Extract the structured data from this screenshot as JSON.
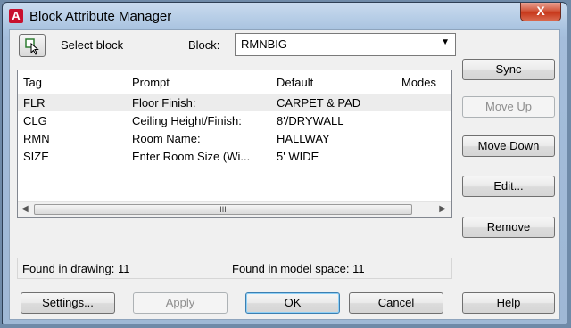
{
  "window": {
    "title": "Block Attribute Manager",
    "app_icon": "autocad-icon",
    "close_glyph": "X"
  },
  "toolbar": {
    "select_block_label": "Select block",
    "block_label": "Block:",
    "block_value": "RMNBIG"
  },
  "table": {
    "columns": [
      "Tag",
      "Prompt",
      "Default",
      "Modes"
    ],
    "rows": [
      {
        "tag": "FLR",
        "prompt": "Floor Finish:",
        "default": "CARPET & PAD",
        "modes": ""
      },
      {
        "tag": "CLG",
        "prompt": "Ceiling Height/Finish:",
        "default": "8'/DRYWALL",
        "modes": ""
      },
      {
        "tag": "RMN",
        "prompt": "Room Name:",
        "default": "HALLWAY",
        "modes": ""
      },
      {
        "tag": "SIZE",
        "prompt": "Enter Room Size (Wi...",
        "default": "5' WIDE",
        "modes": ""
      }
    ],
    "selected_row": 0
  },
  "side_buttons": {
    "sync": "Sync",
    "move_up": "Move Up",
    "move_down": "Move Down",
    "edit": "Edit...",
    "remove": "Remove"
  },
  "status": {
    "found_in_drawing": "Found in drawing: 11",
    "found_in_model_space": "Found in model space: 11"
  },
  "bottom_buttons": {
    "settings": "Settings...",
    "apply": "Apply",
    "ok": "OK",
    "cancel": "Cancel",
    "help": "Help"
  },
  "scrollbar": {
    "left_glyph": "◀",
    "right_glyph": "▶",
    "thumb_glyph": "III"
  },
  "colors": {
    "close_button": "#c7371a",
    "title_gradient": "#a9c3e0",
    "selected_row": "#ececec"
  }
}
